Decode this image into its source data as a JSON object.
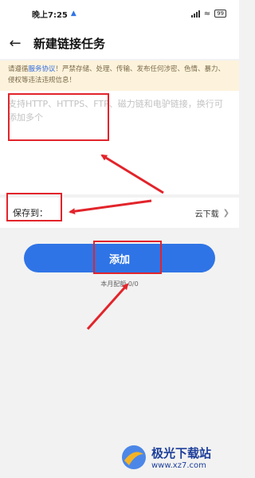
{
  "status_bar": {
    "time": "晚上7:25",
    "battery": "99"
  },
  "header": {
    "title": "新建链接任务"
  },
  "notice": {
    "prefix": "请遵循",
    "link": "服务协议",
    "suffix": "！严禁存储、处理、传输、发布任何涉密、色情、暴力、侵权等违法违规信息！"
  },
  "input": {
    "placeholder": "支持HTTP、HTTPS、FTP、磁力链和电驴链接，换行可添加多个"
  },
  "save_to": {
    "label": "保存到：",
    "value": "云下载"
  },
  "add_button": {
    "label": "添加"
  },
  "quota": {
    "text": "本月配额 0/0"
  },
  "watermark": {
    "name": "极光下载站",
    "url": "www.xz7.com"
  },
  "colors": {
    "accent": "#2f74e6",
    "annotation": "#e2242b",
    "notice_bg": "#fdf3dc"
  }
}
